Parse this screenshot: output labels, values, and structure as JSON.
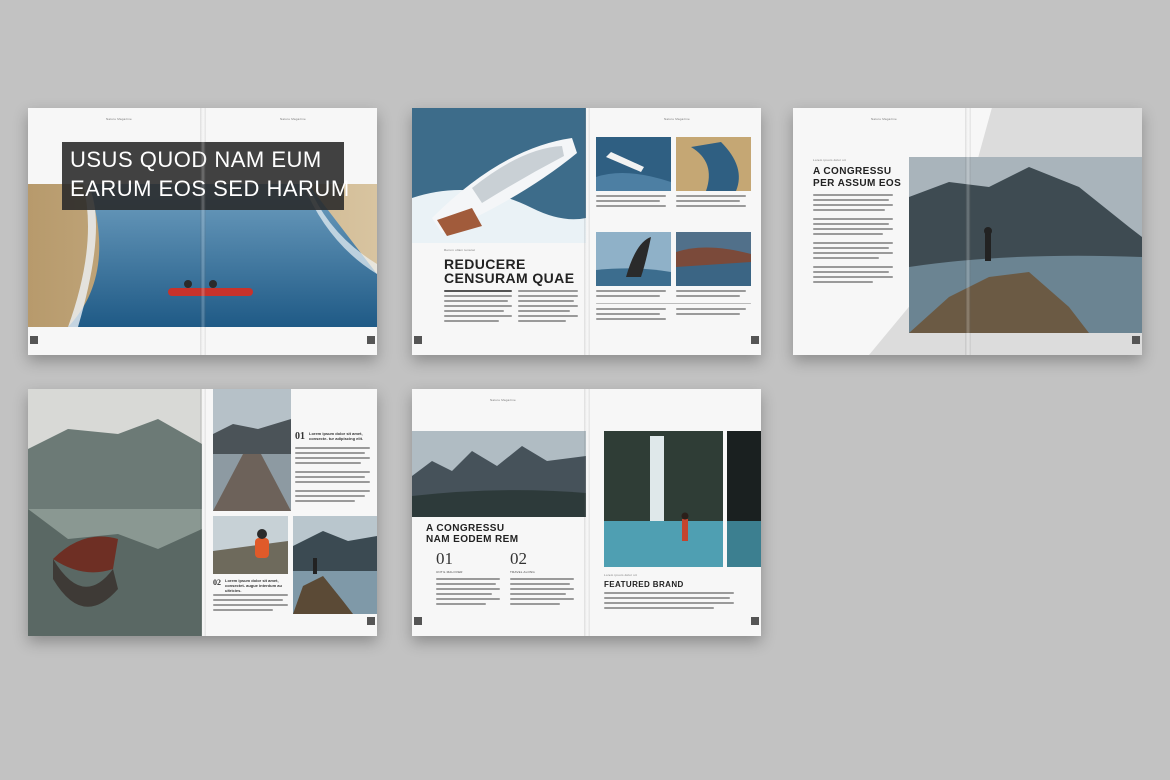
{
  "spreads": [
    {
      "header_left": "Nature Magazine",
      "header_right": "Nature Magazine",
      "headline_line1": "USUS QUOD NAM EUM",
      "headline_line2": "EARUM EOS SED HARUM"
    },
    {
      "header": "Nature Magazine",
      "kicker": "Rerum ullam tenarat",
      "headline_line1": "REDUCERE",
      "headline_line2": "CENSURAM QUAE"
    },
    {
      "header": "Nature Magazine",
      "kicker": "Lorem ipsum dolor sit",
      "headline_line1": "A CONGRESSU",
      "headline_line2": "PER ASSUM EOS"
    },
    {
      "item1_number": "01",
      "item1_text": "Lorem ipsum dolor sit amet, consecte- tur adipiscing elit.",
      "item2_number": "02",
      "item2_text": "Lorem ipsum dolor sit amet, consectet- augue interdum au ultricies."
    },
    {
      "header": "Nature Magazine",
      "headline_line1": "A CONGRESSU",
      "headline_line2": "NAM EODEM REM",
      "col1_number": "01",
      "col1_label": "UNTIL MALOVER",
      "col2_number": "02",
      "col2_label": "TRAVEL ALONG",
      "kicker": "Lorem ipsum dolor sit",
      "feature_title": "FEATURED BRAND"
    }
  ]
}
